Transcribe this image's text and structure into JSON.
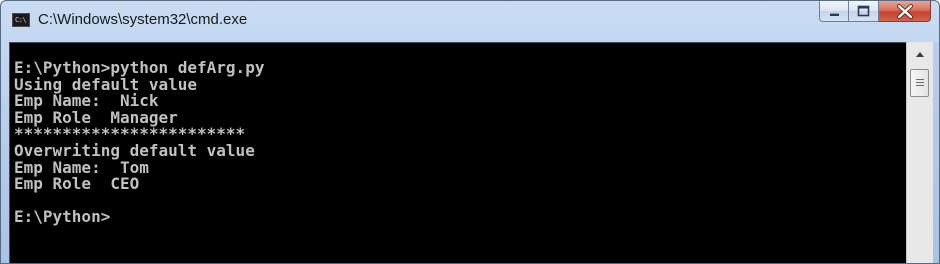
{
  "window": {
    "title": "C:\\Windows\\system32\\cmd.exe",
    "icon": "cmd-icon",
    "icon_text": "C:\\"
  },
  "caption_buttons": [
    {
      "name": "minimize",
      "icon": "minimize-icon"
    },
    {
      "name": "maximize",
      "icon": "maximize-icon"
    },
    {
      "name": "close",
      "icon": "close-icon"
    }
  ],
  "console": {
    "lines": [
      "E:\\Python>python defArg.py",
      "Using default value",
      "Emp Name:  Nick",
      "Emp Role  Manager",
      "************************",
      "Overwriting default value",
      "Emp Name:  Tom",
      "Emp Role  CEO",
      "",
      "E:\\Python>"
    ]
  },
  "scrollbar": {
    "up_icon": "scroll-up-arrow-icon",
    "thumb_icon": "scroll-thumb-grip-icon"
  },
  "colors": {
    "console_bg": "#000000",
    "console_text": "#c0c0c0",
    "titlebar": "#b8cfec",
    "close_button": "#c5432f"
  }
}
